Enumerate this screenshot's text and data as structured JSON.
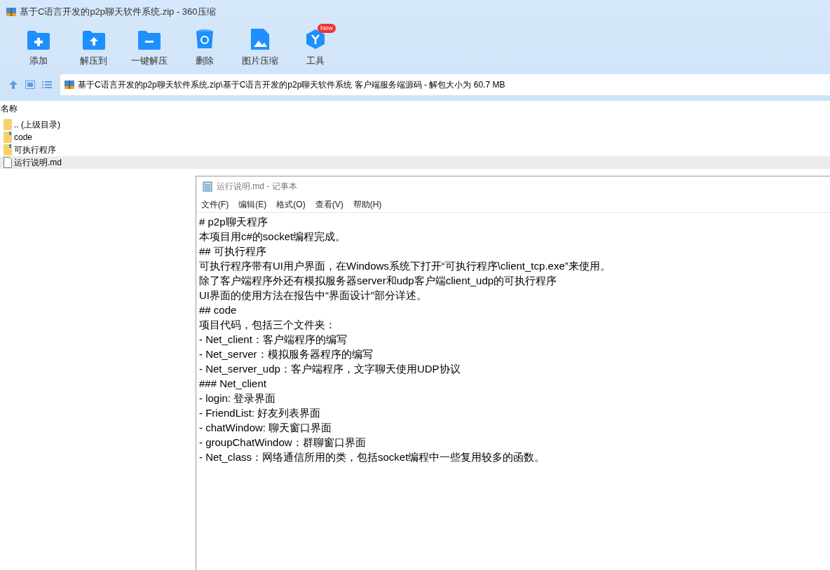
{
  "window": {
    "title": "基于C语言开发的p2p聊天软件系统.zip - 360压缩"
  },
  "toolbar": [
    {
      "kind": "add",
      "label": "添加"
    },
    {
      "kind": "extract_to",
      "label": "解压到"
    },
    {
      "kind": "extract",
      "label": "一键解压"
    },
    {
      "kind": "delete",
      "label": "删除"
    },
    {
      "kind": "image",
      "label": "图片压缩"
    },
    {
      "kind": "tools",
      "label": "工具",
      "badge": "New"
    }
  ],
  "address_bar": {
    "path": "基于C语言开发的p2p聊天软件系统.zip\\基于C语言开发的p2p聊天软件系统 客户端服务端源码 - 解包大小为 60.7 MB"
  },
  "file_list": {
    "columns": [
      "名称"
    ],
    "rows": [
      {
        "kind": "parent",
        "name": ".. (上级目录)",
        "selected": false
      },
      {
        "kind": "folder",
        "name": "code",
        "selected": false
      },
      {
        "kind": "folder",
        "name": "可执行程序",
        "selected": false
      },
      {
        "kind": "file",
        "name": "运行说明.md",
        "selected": true
      }
    ]
  },
  "notepad": {
    "title": "运行说明.md - 记事本",
    "menu": [
      "文件(F)",
      "编辑(E)",
      "格式(O)",
      "查看(V)",
      "帮助(H)"
    ],
    "lines": [
      "# p2p聊天程序",
      "本项目用c#的socket编程完成。",
      "## 可执行程序",
      "可执行程序带有UI用户界面，在Windows系统下打开“可执行程序\\client_tcp.exe”来使用。",
      "除了客户端程序外还有模拟服务器server和udp客户端client_udp的可执行程序",
      "UI界面的使用方法在报告中“界面设计”部分详述。",
      "## code",
      "项目代码，包括三个文件夹：",
      "- Net_client：客户端程序的编写",
      "- Net_server：模拟服务器程序的编写",
      "- Net_server_udp：客户端程序，文字聊天使用UDP协议",
      "### Net_client",
      "- login: 登录界面",
      "- FriendList: 好友列表界面",
      "- chatWindow: 聊天窗口界面",
      "- groupChatWindow：群聊窗口界面",
      "- Net_class：网络通信所用的类，包括socket编程中一些复用较多的函数。"
    ]
  }
}
